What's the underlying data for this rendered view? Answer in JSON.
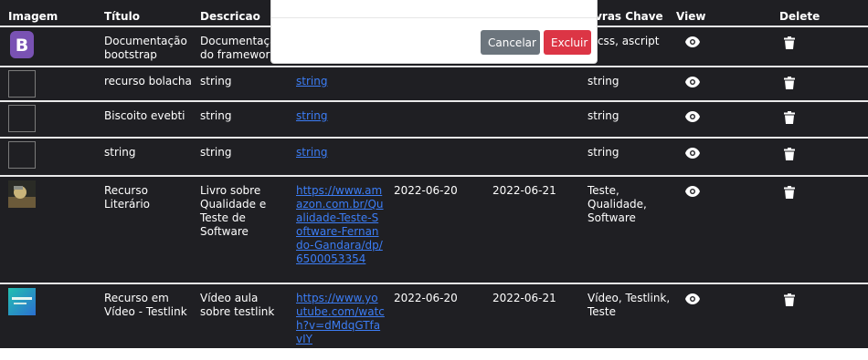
{
  "headers": {
    "image": "Imagem",
    "title": "Título",
    "description": "Descricao",
    "keywords": "avras Chave",
    "view": "View",
    "delete": "Delete"
  },
  "rows": [
    {
      "title": "Documentação bootstrap",
      "description": "Documentaçã do framework",
      "link": "",
      "date1": "",
      "date2": "",
      "keywords": "l, css, ascript",
      "thumb": "bootstrap-logo"
    },
    {
      "title": "recurso bolacha",
      "description": "string",
      "link": "string",
      "date1": "",
      "date2": "",
      "keywords": "string",
      "thumb": "empty"
    },
    {
      "title": "Biscoito evebti",
      "description": "string",
      "link": "string",
      "date1": "",
      "date2": "",
      "keywords": "string",
      "thumb": "empty"
    },
    {
      "title": "string",
      "description": "string",
      "link": "string",
      "date1": "",
      "date2": "",
      "keywords": "string",
      "thumb": "empty"
    },
    {
      "title": "Recurso Literário",
      "description": "Livro sobre Qualidade e Teste de Software",
      "link": "https://www.amazon.com.br/Qualidade-Teste-Software-Fernando-Gandara/dp/6500053354",
      "date1": "2022-06-20",
      "date2": "2022-06-21",
      "keywords": "Teste, Qualidade, Software",
      "thumb": "book-cover"
    },
    {
      "title": "Recurso em Vídeo - Testlink",
      "description": "Vídeo aula sobre testlink",
      "link": "https://www.youtube.com/watch?v=dMdqGTfavIY",
      "date1": "2022-06-20",
      "date2": "2022-06-21",
      "keywords": "Vídeo, Testlink, Teste",
      "thumb": "video-thumb"
    }
  ],
  "modal": {
    "cancel_label": "Cancelar",
    "delete_label": "Excluir"
  },
  "icons": {
    "view": "eye-icon",
    "delete": "trash-icon"
  },
  "colors": {
    "table_bg": "#1f1f23",
    "link": "#3c7df5",
    "cancel": "#6c757d",
    "danger": "#dc3545",
    "bootstrap_purple": "#7952b3"
  }
}
